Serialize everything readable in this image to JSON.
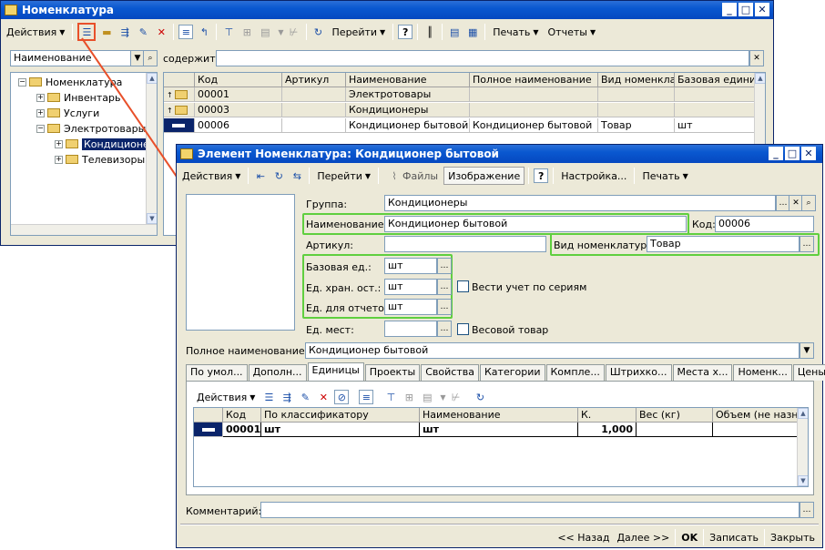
{
  "back_window": {
    "title": "Номенклатура",
    "toolbar": {
      "actions": "Действия",
      "goto": "Перейти",
      "help": "?",
      "print": "Печать",
      "reports": "Отчеты"
    },
    "filter": {
      "field_select": "Наименование",
      "contains_label": "содержит:",
      "contains_value": ""
    },
    "tree": [
      {
        "label": "Номенклатура",
        "level": 0,
        "expander": "−"
      },
      {
        "label": "Инвентарь",
        "level": 1,
        "expander": "+"
      },
      {
        "label": "Услуги",
        "level": 1,
        "expander": "+"
      },
      {
        "label": "Электротовары",
        "level": 1,
        "expander": "−"
      },
      {
        "label": "Кондиционер",
        "level": 2,
        "expander": "+",
        "selected": true
      },
      {
        "label": "Телевизоры",
        "level": 2,
        "expander": "+"
      }
    ],
    "list_columns": [
      "Код",
      "Артикул",
      "Наименование",
      "Полное наименование",
      "Вид номенкла...",
      "Базовая единиц"
    ],
    "list_rows": [
      {
        "code": "00001",
        "article": "",
        "name": "Электротовары",
        "full_name": "",
        "kind": "",
        "unit": "",
        "type": "folder"
      },
      {
        "code": "00003",
        "article": "",
        "name": "Кондиционеры",
        "full_name": "",
        "kind": "",
        "unit": "",
        "type": "folder"
      },
      {
        "code": "00006",
        "article": "",
        "name": "Кондиционер бытовой",
        "full_name": "Кондиционер бытовой",
        "kind": "Товар",
        "unit": "шт",
        "type": "item"
      }
    ]
  },
  "front_window": {
    "title": "Элемент Номенклатура: Кондиционер бытовой",
    "toolbar": {
      "actions": "Действия",
      "goto": "Перейти",
      "files": "Файлы",
      "image": "Изображение",
      "help": "?",
      "settings": "Настройка...",
      "print": "Печать"
    },
    "form": {
      "group_label": "Группа:",
      "group_value": "Кондиционеры",
      "name_label": "Наименование:",
      "name_value": "Кондиционер бытовой",
      "code_label": "Код:",
      "code_value": "00006",
      "article_label": "Артикул:",
      "article_value": "",
      "kind_label": "Вид номенклатуры:",
      "kind_value": "Товар",
      "base_unit_label": "Базовая ед.:",
      "base_unit_value": "шт",
      "storage_unit_label": "Ед. хран. ост.:",
      "storage_unit_value": "шт",
      "report_unit_label": "Ед. для отчетов:",
      "report_unit_value": "шт",
      "place_unit_label": "Ед. мест:",
      "place_unit_value": "",
      "series_checkbox": "Вести учет по сериям",
      "weight_checkbox": "Весовой товар",
      "full_name_label": "Полное наименование:",
      "full_name_value": "Кондиционер бытовой",
      "comment_label": "Комментарий:",
      "comment_value": ""
    },
    "tabs": [
      "По умол...",
      "Дополн...",
      "Единицы",
      "Проекты",
      "Свойства",
      "Категории",
      "Компле...",
      "Штрихко...",
      "Места х...",
      "Номенк...",
      "Цены но..."
    ],
    "active_tab": "Единицы",
    "units_toolbar": {
      "actions": "Действия"
    },
    "units_columns": [
      "Код",
      "По классификатору",
      "Наименование",
      "К.",
      "Вес (кг)",
      "Объем (не назн..."
    ],
    "units_rows": [
      {
        "code": "00001",
        "classifier": "шт",
        "name": "шт",
        "k": "1,000",
        "weight": "",
        "volume": ""
      }
    ],
    "footer": {
      "back": "<< Назад",
      "next": "Далее >>",
      "ok": "OK",
      "save": "Записать",
      "close": "Закрыть"
    }
  },
  "colors": {
    "title_bar": "#0a58d0",
    "highlight": "#5fcf3f",
    "callout": "#e8502a",
    "window_bg": "#ece9d8",
    "selection": "#0a246a"
  }
}
